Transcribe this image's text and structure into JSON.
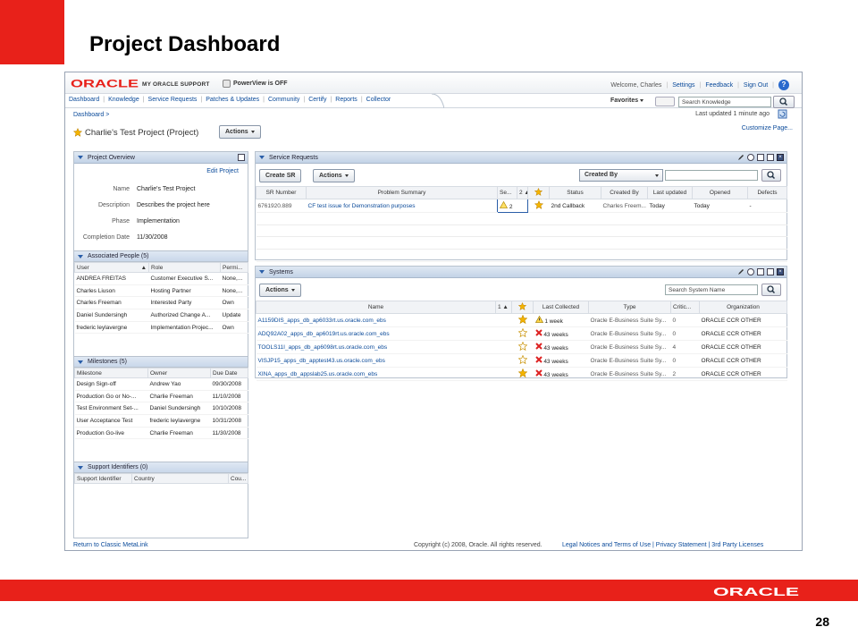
{
  "slide": {
    "title": "Project Dashboard",
    "page_number": "28",
    "footer_logo_text": "ORACLE",
    "brand_color": "#e8211a"
  },
  "app": {
    "logo_text": "ORACLE",
    "product": "MY ORACLE SUPPORT",
    "powerview": "PowerView is OFF",
    "welcome": "Welcome, Charles",
    "top_links": [
      "Settings",
      "Feedback",
      "Sign Out"
    ],
    "help_label": "?"
  },
  "tabs": [
    "Dashboard",
    "Knowledge",
    "Service Requests",
    "Patches & Updates",
    "Community",
    "Certify",
    "Reports",
    "Collector"
  ],
  "favorites_label": "Favorites",
  "search_knowledge_placeholder": "Search Knowledge",
  "breadcrumb": "Dashboard >",
  "last_updated": "Last updated 1 minute ago",
  "project": {
    "title": "Charlie's Test Project  (Project)",
    "actions_label": "Actions",
    "customize_label": "Customize Page..."
  },
  "overview": {
    "header": "Project Overview",
    "edit_label": "Edit Project",
    "fields": [
      {
        "label": "Name",
        "value": "Charlie's Test Project"
      },
      {
        "label": "Description",
        "value": "Describes the project here"
      },
      {
        "label": "Phase",
        "value": "Implementation"
      },
      {
        "label": "Completion Date",
        "value": "11/30/2008"
      }
    ]
  },
  "people": {
    "header": "Associated People (5)",
    "columns": [
      "User",
      "Role",
      "Permi..."
    ],
    "sort_indicator": "▲",
    "rows": [
      [
        "ANDREA FREITAS",
        "Customer Executive S...",
        "None,..."
      ],
      [
        "Charles Liuson",
        "Hosting Partner",
        "None,..."
      ],
      [
        "Charles Freeman",
        "Interested Party",
        "Own"
      ],
      [
        "Daniel Sundersingh",
        "Authorized Change A...",
        "Update"
      ],
      [
        "frederic leylavergne",
        "Implementation Projec...",
        "Own"
      ]
    ]
  },
  "milestones": {
    "header": "Milestones (5)",
    "columns": [
      "Milestone",
      "Owner",
      "Due Date"
    ],
    "rows": [
      [
        "Design Sign-off",
        "Andrew Yao",
        "09/30/2008"
      ],
      [
        "Production Go or No-...",
        "Charlie Freeman",
        "11/10/2008"
      ],
      [
        "Test Environment Set-...",
        "Daniel Sundersingh",
        "10/10/2008"
      ],
      [
        "User Acceptance Test",
        "frederic leylavergne",
        "10/31/2008"
      ],
      [
        "Production Go-live",
        "Charlie Freeman",
        "11/30/2008"
      ]
    ]
  },
  "support_ids": {
    "header": "Support Identifiers (0)",
    "columns": [
      "Support Identifier",
      "Country",
      "Cou..."
    ]
  },
  "service_requests": {
    "header": "Service Requests",
    "create_label": "Create SR",
    "actions_label": "Actions",
    "filter_label": "Created By",
    "columns": [
      "SR Number",
      "Problem Summary",
      "Se...",
      "2 ▲",
      "",
      "Status",
      "Created By",
      "Last updated",
      "Opened",
      "Defects"
    ],
    "rows": [
      {
        "sr": "6761920.889",
        "summary": "CF test issue for Demonstration purposes",
        "severity": "2",
        "status": "2nd Callback",
        "created_by": "Charles Freem...",
        "last_updated": "Today",
        "opened": "Today",
        "defects": "-"
      }
    ]
  },
  "systems": {
    "header": "Systems",
    "actions_label": "Actions",
    "search_placeholder": "Search System Name",
    "columns": [
      "Name",
      "1 ▲",
      "",
      "Last Collected",
      "Type",
      "Critic...",
      "Organization"
    ],
    "rows": [
      {
        "name": "A1159DIS_apps_db_ap6033rt.us.oracle.com_ebs",
        "fav": true,
        "status": "warning",
        "collected": "1 week",
        "type": "Oracle E-Business Suite Sy...",
        "critical": "0",
        "org": "ORACLE CCR OTHER"
      },
      {
        "name": "ADQ92A02_apps_db_ap6019rt.us.oracle.com_ebs",
        "fav": false,
        "status": "error",
        "collected": "43 weeks",
        "type": "Oracle E-Business Suite Sy...",
        "critical": "0",
        "org": "ORACLE CCR OTHER"
      },
      {
        "name": "TOOLS11I_apps_db_ap6098rt.us.oracle.com_ebs",
        "fav": false,
        "status": "error",
        "collected": "43 weeks",
        "type": "Oracle E-Business Suite Sy...",
        "critical": "4",
        "org": "ORACLE CCR OTHER"
      },
      {
        "name": "VISJP15_apps_db_apptest43.us.oracle.com_ebs",
        "fav": false,
        "status": "error",
        "collected": "43 weeks",
        "type": "Oracle E-Business Suite Sy...",
        "critical": "0",
        "org": "ORACLE CCR OTHER"
      },
      {
        "name": "XINA_apps_db_appslab25.us.oracle.com_ebs",
        "fav": true,
        "status": "error",
        "collected": "43 weeks",
        "type": "Oracle E-Business Suite Sy...",
        "critical": "2",
        "org": "ORACLE CCR OTHER"
      }
    ]
  },
  "footer": {
    "return_link": "Return to Classic MetaLink",
    "copyright": "Copyright (c) 2008, Oracle. All rights reserved.",
    "legal_links": "Legal Notices and Terms of Use  |  Privacy Statement  |  3rd Party Licenses"
  }
}
